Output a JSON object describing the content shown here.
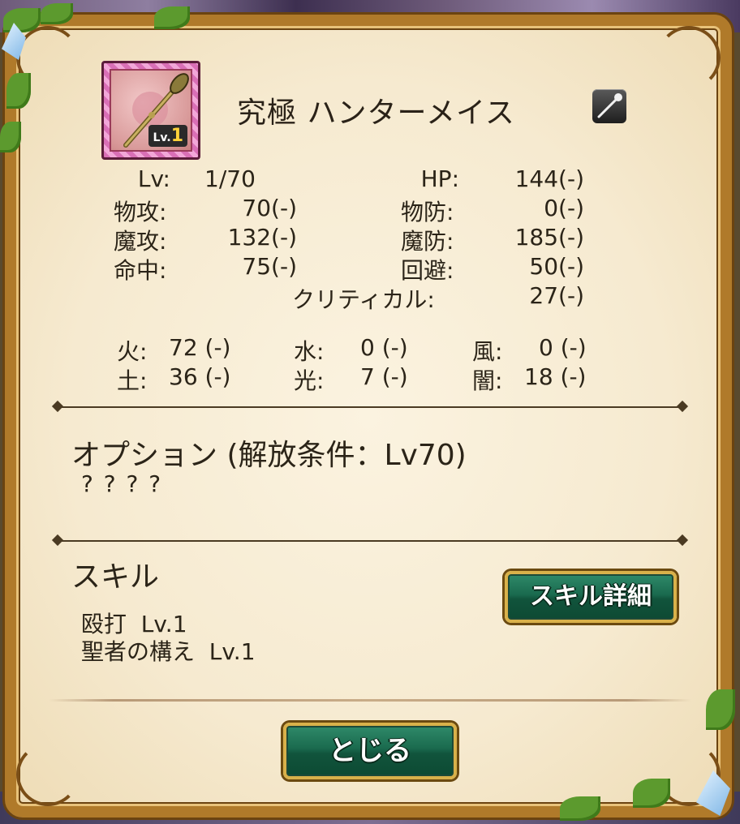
{
  "item": {
    "name": "究極 ハンターメイス",
    "level_badge_prefix": "Lv.",
    "level_badge_num": "1",
    "type_icon": "mace-icon"
  },
  "stats": {
    "lv_label": "Lv:",
    "lv_value": "1/70",
    "hp_label": "HP:",
    "hp_value": "144(-)",
    "patk_label": "物攻:",
    "patk_value": "70(-)",
    "pdef_label": "物防:",
    "pdef_value": "0(-)",
    "matk_label": "魔攻:",
    "matk_value": "132(-)",
    "mdef_label": "魔防:",
    "mdef_value": "185(-)",
    "hit_label": "命中:",
    "hit_value": "75(-)",
    "eva_label": "回避:",
    "eva_value": "50(-)",
    "crit_label": "クリティカル:",
    "crit_value": "27(-)"
  },
  "elements": {
    "fire_label": "火:",
    "fire_value": "72 (-)",
    "water_label": "水:",
    "water_value": "0 (-)",
    "wind_label": "風:",
    "wind_value": "0 (-)",
    "earth_label": "土:",
    "earth_value": "36 (-)",
    "light_label": "光:",
    "light_value": "7 (-)",
    "dark_label": "闇:",
    "dark_value": "18 (-)"
  },
  "option": {
    "title": "オプション (解放条件：Lv70)",
    "text": "? ? ? ?"
  },
  "skill": {
    "title": "スキル",
    "items": [
      "殴打  Lv.1",
      "聖者の構え  Lv.1"
    ],
    "detail_button": "スキル詳細"
  },
  "close_button": "とじる",
  "colors": {
    "button_green": "#1a6a4e",
    "button_border": "#d9b14a",
    "frame": "#b07a2a",
    "panel": "#f6ead0"
  }
}
